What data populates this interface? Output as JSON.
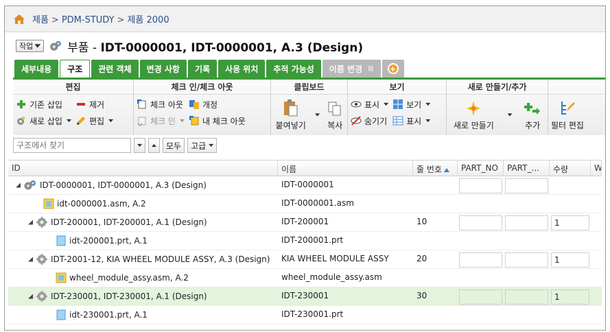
{
  "breadcrumb": [
    "제품",
    "PDM-STUDY",
    "제품 2000"
  ],
  "title": {
    "action_label": "작업",
    "prefix": "부품 - ",
    "main": "IDT-0000001, IDT-0000001, A.3 (Design)"
  },
  "tabs": [
    {
      "label": "세부내용",
      "state": "normal"
    },
    {
      "label": "구조",
      "state": "active"
    },
    {
      "label": "관련 객체",
      "state": "normal"
    },
    {
      "label": "변경 사항",
      "state": "normal"
    },
    {
      "label": "기록",
      "state": "normal"
    },
    {
      "label": "사용 위치",
      "state": "normal"
    },
    {
      "label": "추적 가능성",
      "state": "normal"
    },
    {
      "label": "이름 변경",
      "state": "dim"
    }
  ],
  "ribbon": {
    "edit": {
      "title": "편집",
      "insert_existing": "기존 삽입",
      "remove": "제거",
      "insert_new": "새로 삽입",
      "edit": "편집"
    },
    "checkin": {
      "title": "체크 인/체크 아웃",
      "checkout": "체크 아웃",
      "revise": "개정",
      "checkin": "체크 인",
      "my_checkout": "내 체크 아웃"
    },
    "clipboard": {
      "title": "클립보드",
      "paste": "붙여넣기",
      "copy": "복사"
    },
    "view": {
      "title": "보기",
      "show": "표시",
      "view": "보기",
      "hide": "숨기기",
      "display": "표시"
    },
    "create": {
      "title": "새로 만들기/추가",
      "new": "새로 만들기",
      "add": "추가"
    },
    "filter": {
      "edit": "필터 편집"
    }
  },
  "search": {
    "placeholder": "구조에서 찾기",
    "all": "모두",
    "advanced": "고급"
  },
  "columns": {
    "id": "ID",
    "name": "이름",
    "seq": "줄 번호",
    "part_no": "PART_NO",
    "part2": "PART_...",
    "qty": "수량",
    "w": "W"
  },
  "rows": [
    {
      "id": "IDT-0000001, IDT-0000001, A.3 (Design)",
      "name": "IDT-0000001",
      "seq": "",
      "qty": "",
      "kind": "assembly",
      "level": 0,
      "expand": true,
      "boxes": true
    },
    {
      "id": "idt-0000001.asm, A.2",
      "name": "IDT-0000001.asm",
      "seq": "",
      "qty": "",
      "kind": "asm-file",
      "level": 1,
      "expand": false,
      "boxes": false
    },
    {
      "id": "IDT-200001, IDT-200001, A.1 (Design)",
      "name": "IDT-200001",
      "seq": "10",
      "qty": "1",
      "kind": "part",
      "level": 1,
      "expand": true,
      "boxes": true
    },
    {
      "id": "idt-200001.prt, A.1",
      "name": "IDT-200001.prt",
      "seq": "",
      "qty": "",
      "kind": "prt-file",
      "level": 2,
      "expand": false,
      "boxes": false
    },
    {
      "id": "IDT-2001-12, KIA WHEEL MODULE ASSY, A.3 (Design)",
      "name": "KIA WHEEL MODULE ASSY",
      "seq": "20",
      "qty": "1",
      "kind": "part",
      "level": 1,
      "expand": true,
      "boxes": true
    },
    {
      "id": "wheel_module_assy.asm, A.2",
      "name": "wheel_module_assy.asm",
      "seq": "",
      "qty": "",
      "kind": "asm-file",
      "level": 2,
      "expand": false,
      "boxes": false
    },
    {
      "id": "IDT-230001, IDT-230001, A.1 (Design)",
      "name": "IDT-230001",
      "seq": "30",
      "qty": "1",
      "kind": "part",
      "level": 1,
      "expand": true,
      "boxes": true,
      "selected": true
    },
    {
      "id": "idt-230001.prt, A.1",
      "name": "IDT-230001.prt",
      "seq": "",
      "qty": "",
      "kind": "prt-file",
      "level": 2,
      "expand": false,
      "boxes": false
    }
  ],
  "colors": {
    "accent_green": "#3c9a3a",
    "selected_row": "#e3f3dc",
    "link": "#2a4f8a",
    "orange": "#f0a02a"
  }
}
